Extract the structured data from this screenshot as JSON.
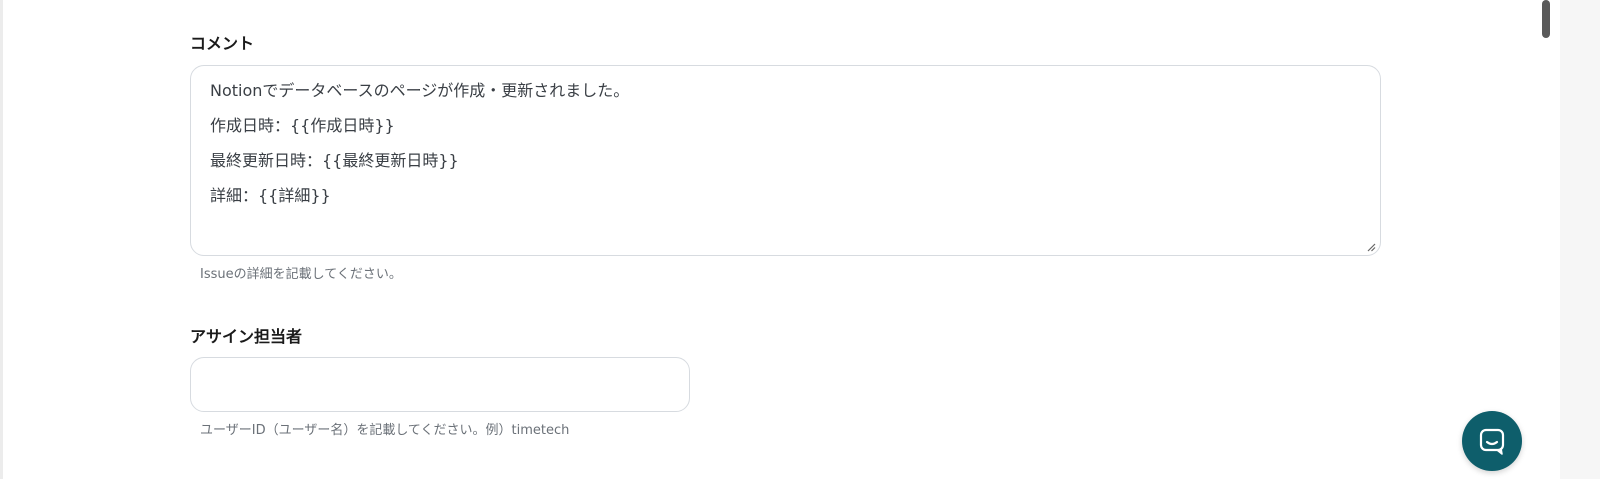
{
  "comment": {
    "label": "コメント",
    "lines": [
      "Notionでデータベースのページが作成・更新されました。",
      "作成日時：{{作成日時}}",
      "最終更新日時：{{最終更新日時}}",
      "詳細：{{詳細}}"
    ],
    "help": "Issueの詳細を記載してください。"
  },
  "assignee": {
    "label": "アサイン担当者",
    "value": "",
    "help": "ユーザーID（ユーザー名）を記載してください。例）timetech"
  },
  "chat": {
    "icon": "chat-bubble-icon",
    "accent": "#0e5e6b"
  }
}
